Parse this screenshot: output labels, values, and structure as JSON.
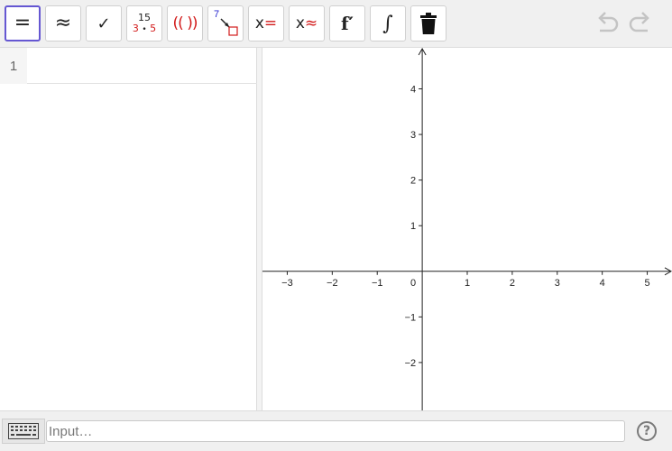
{
  "toolbar": {
    "tools": [
      {
        "name": "evaluate",
        "label": "="
      },
      {
        "name": "numeric",
        "label": "≈"
      },
      {
        "name": "keep-input",
        "label": "✓"
      },
      {
        "name": "factor",
        "top": "15",
        "bottom_a": "3",
        "bottom_dot": "•",
        "bottom_b": "5"
      },
      {
        "name": "expand",
        "label": "(( ))"
      },
      {
        "name": "substitute",
        "label": "7"
      },
      {
        "name": "solve",
        "x": "x",
        "op": "="
      },
      {
        "name": "solve-numerically",
        "x": "x",
        "op": "≈"
      },
      {
        "name": "derivative",
        "label": "f′"
      },
      {
        "name": "integral",
        "label": "∫"
      },
      {
        "name": "delete",
        "icon": "trash-icon"
      }
    ],
    "undo_icon": "undo-icon",
    "redo_icon": "redo-icon",
    "colors": {
      "selected_border": "#6557d2",
      "accent_red": "#d21a1a"
    }
  },
  "algebra": {
    "rows": [
      {
        "number": "1",
        "content": ""
      }
    ]
  },
  "graphics": {
    "x_ticks": [
      "−3",
      "−2",
      "−1",
      "1",
      "2",
      "3",
      "4",
      "5"
    ],
    "x_tick_values": [
      -3,
      -2,
      -1,
      1,
      2,
      3,
      4,
      5
    ],
    "y_ticks": [
      "4",
      "3",
      "2",
      "1",
      "−1",
      "−2"
    ],
    "y_tick_values": [
      4,
      3,
      2,
      1,
      -1,
      -2
    ],
    "origin_label": "0",
    "x_range": [
      -3.55,
      5.55
    ],
    "y_range": [
      -3.05,
      4.9
    ]
  },
  "inputbar": {
    "placeholder": "Input…",
    "value": "",
    "help_label": "?"
  }
}
